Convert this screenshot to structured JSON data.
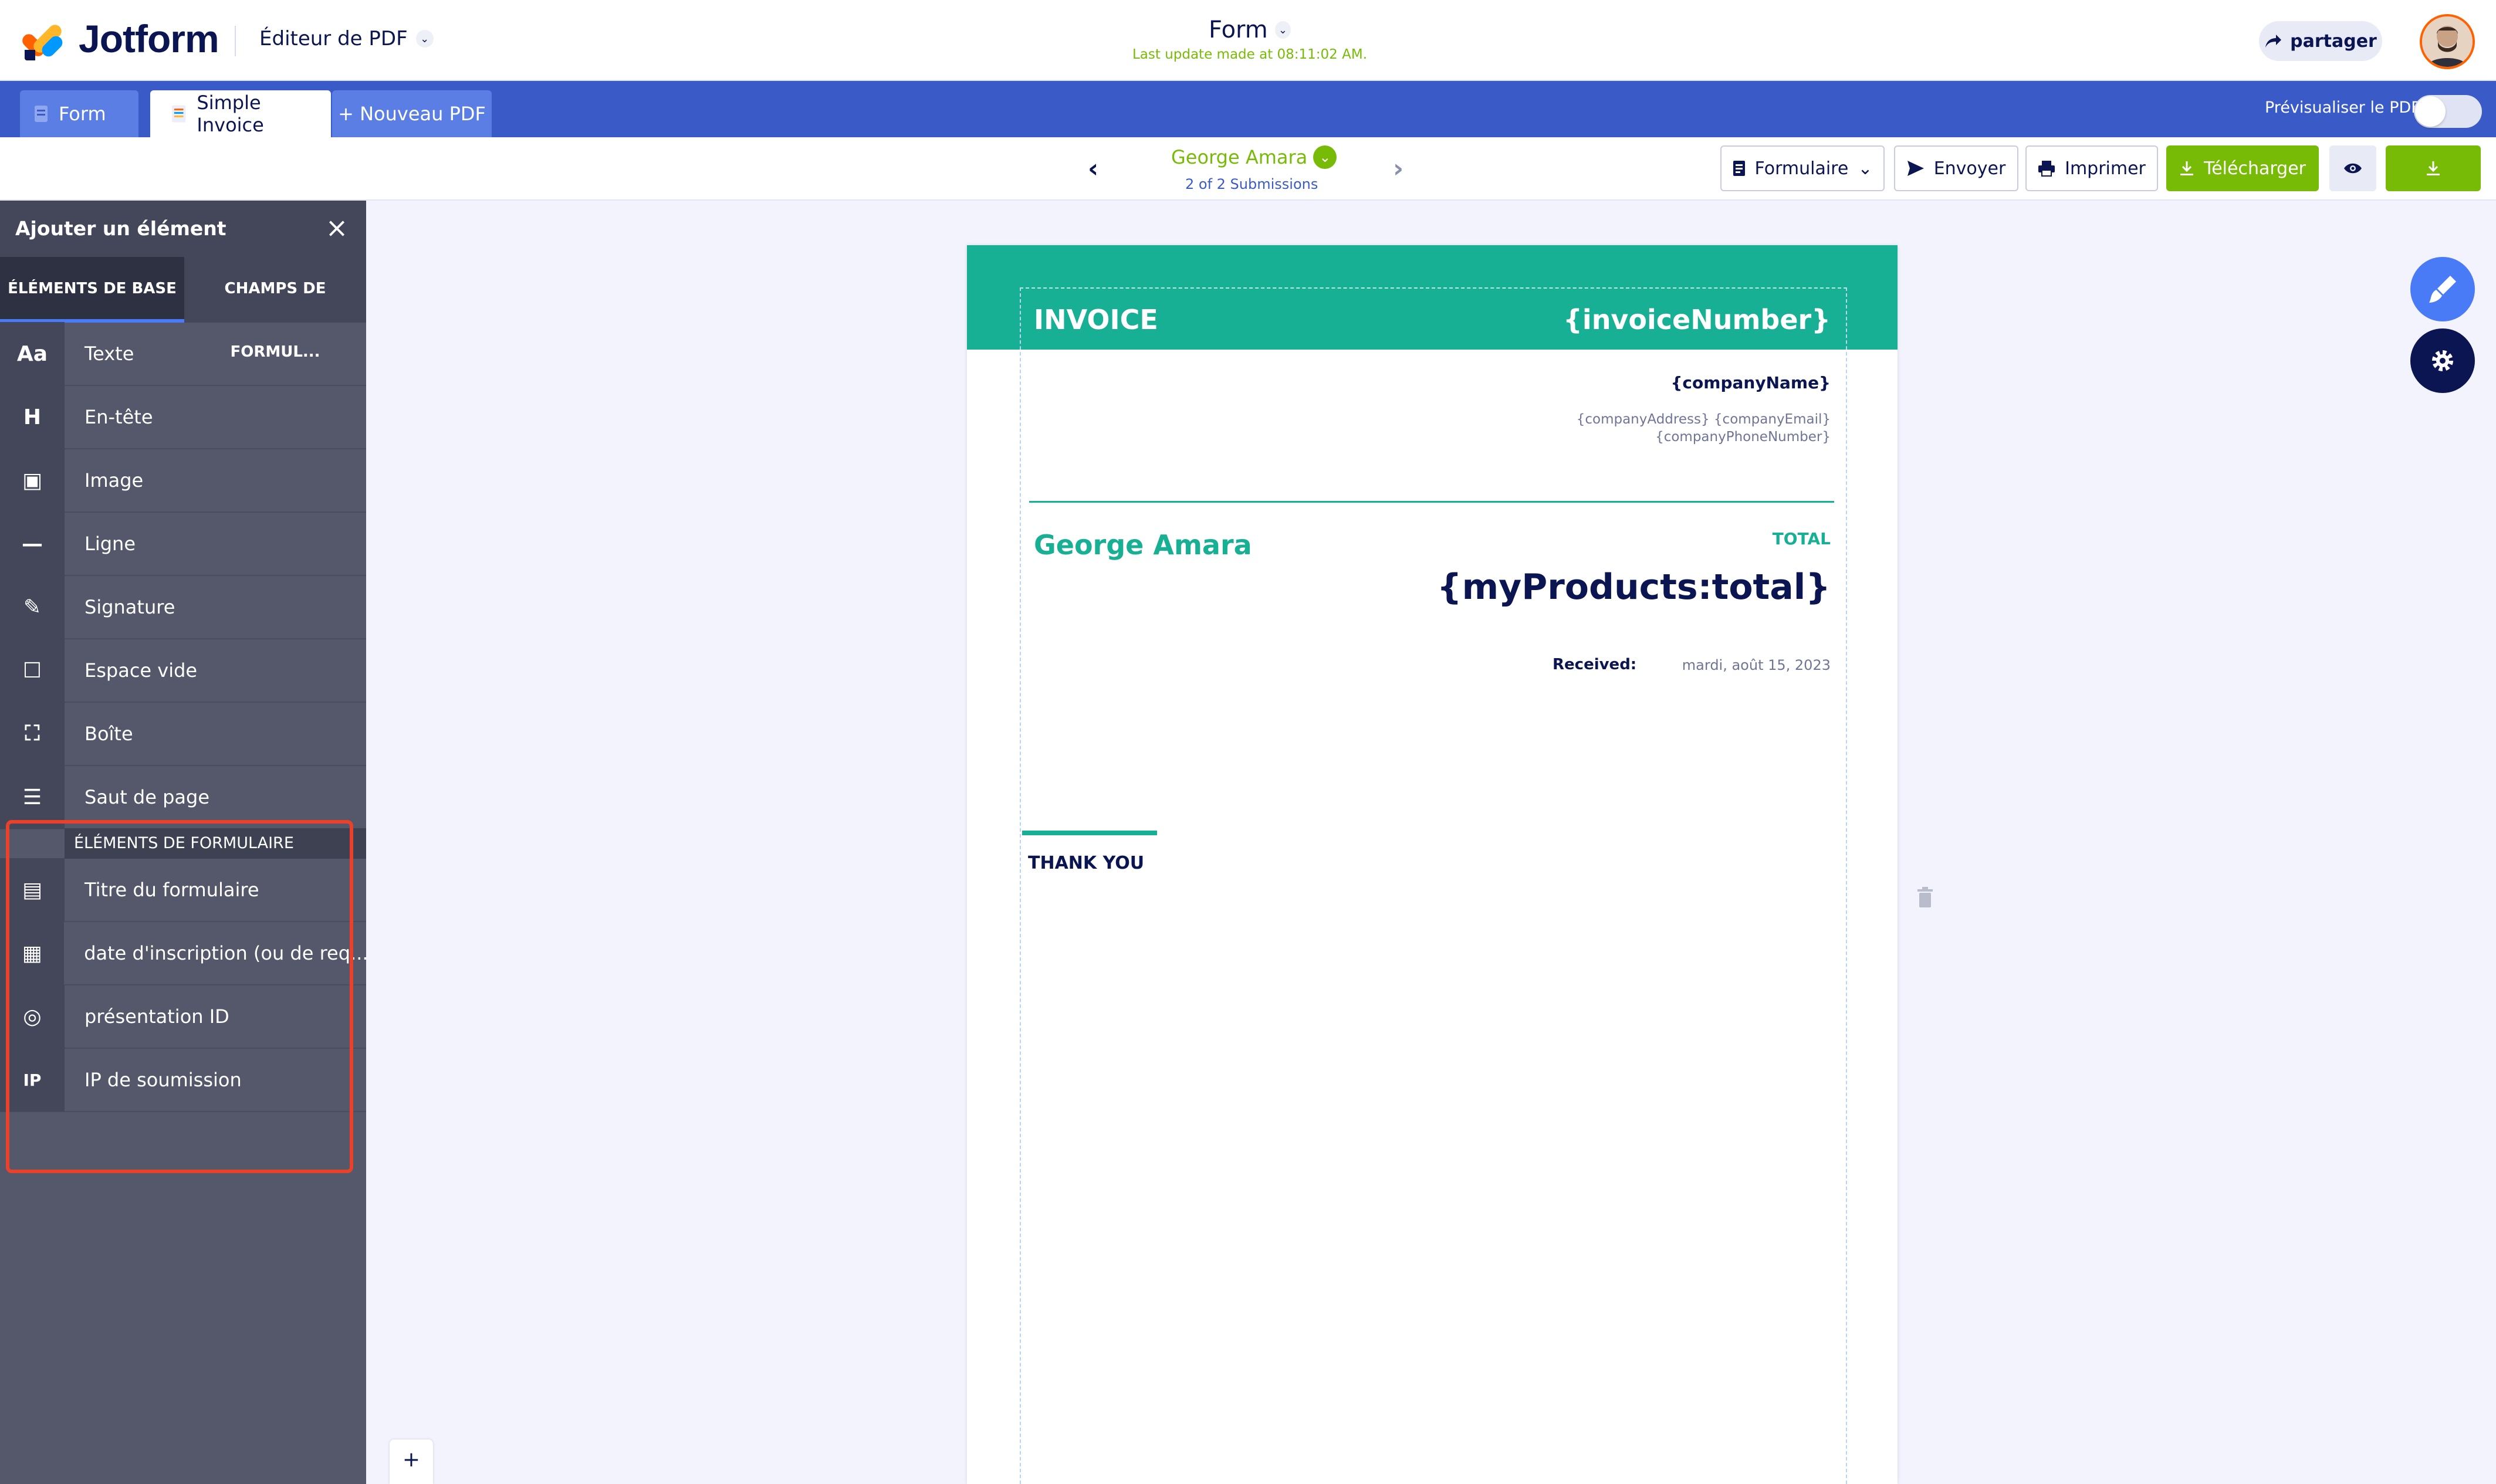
{
  "header": {
    "brand": "Jotform",
    "editor_label": "Éditeur de PDF",
    "form_title": "Form",
    "last_update": "Last update made at 08:11:02 AM.",
    "share_label": "partager"
  },
  "tabs": {
    "form": "Form",
    "invoice": "Simple Invoice",
    "new_pdf": "+ Nouveau PDF",
    "preview_label": "Prévisualiser le PDF",
    "preview_enabled": false
  },
  "submission": {
    "name": "George Amara",
    "count": "2 of 2 Submissions"
  },
  "toolbar": {
    "form_label": "Formulaire",
    "send_label": "Envoyer",
    "print_label": "Imprimer",
    "download_label": "Télécharger"
  },
  "sidebar": {
    "title": "Ajouter un élément",
    "tab_basic": "ÉLÉMENTS DE BASE",
    "tab_fields": "CHAMPS DE FORMUL...",
    "basic_items": [
      {
        "icon": "text-icon",
        "glyph": "Aa",
        "label": "Texte"
      },
      {
        "icon": "heading-icon",
        "glyph": "H",
        "label": "En-tête"
      },
      {
        "icon": "image-icon",
        "glyph": "▣",
        "label": "Image"
      },
      {
        "icon": "line-icon",
        "glyph": "—",
        "label": "Ligne"
      },
      {
        "icon": "signature-icon",
        "glyph": "✎",
        "label": "Signature"
      },
      {
        "icon": "empty-space-icon",
        "glyph": "☐",
        "label": "Espace vide"
      },
      {
        "icon": "box-icon",
        "glyph": "⛶",
        "label": "Boîte"
      },
      {
        "icon": "page-break-icon",
        "glyph": "☰",
        "label": "Saut de page"
      }
    ],
    "form_section": "ÉLÉMENTS DE FORMULAIRE",
    "form_items": [
      {
        "icon": "form-title-icon",
        "glyph": "▤",
        "label": "Titre du formulaire"
      },
      {
        "icon": "calendar-icon",
        "glyph": "▦",
        "label": "date d'inscription (ou de req..."
      },
      {
        "icon": "fingerprint-icon",
        "glyph": "◎",
        "label": "présentation ID"
      },
      {
        "icon": "ip-icon",
        "glyph": "IP",
        "label": "IP de soumission"
      }
    ]
  },
  "invoice": {
    "title": "INVOICE",
    "number": "{invoiceNumber}",
    "company_name": "{companyName}",
    "company_address_line1": "{companyAddress} {companyEmail}",
    "company_address_line2": "{companyPhoneNumber}",
    "client": "George Amara",
    "total_label": "TOTAL",
    "total_value": "{myProducts:total}",
    "received_label": "Received:",
    "received_value": "mardi, août 15, 2023",
    "thanks": "THANK YOU"
  },
  "colors": {
    "accent_teal": "#17b094",
    "tab_blue": "#3a5bc7",
    "success_green": "#78bb07",
    "highlight_red": "#e9412a",
    "navy": "#0a1551"
  }
}
